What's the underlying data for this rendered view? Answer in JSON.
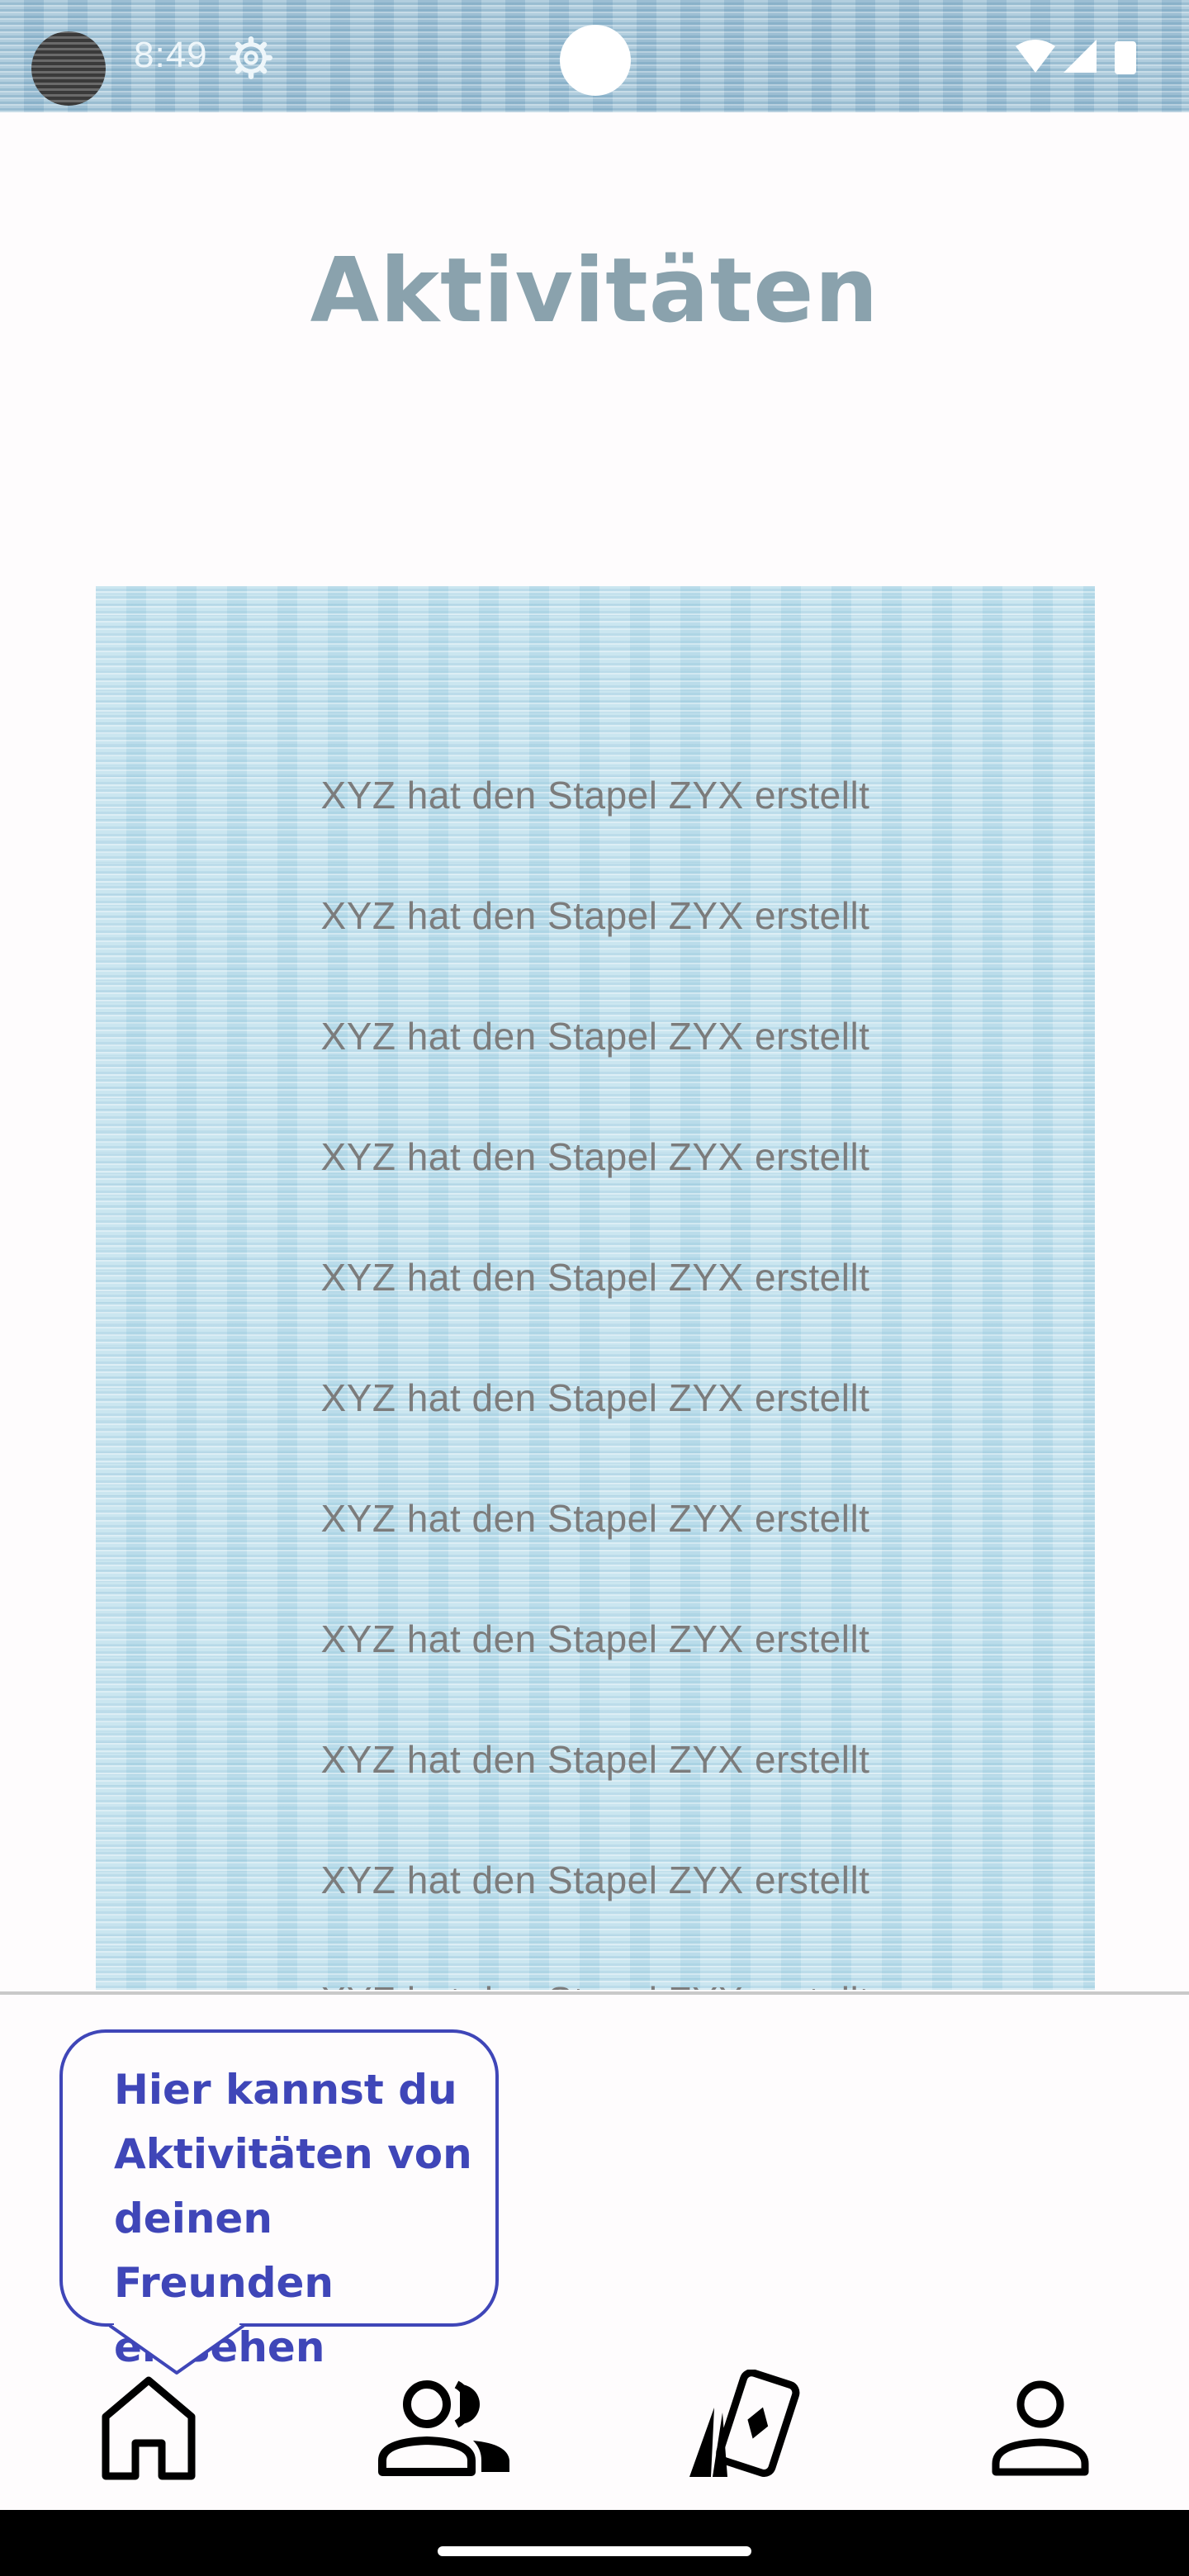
{
  "status_bar": {
    "time": "8:49",
    "icons": [
      "settings-gear-icon",
      "wifi-icon",
      "cellular-signal-icon",
      "battery-icon"
    ]
  },
  "page": {
    "title": "Aktivitäten"
  },
  "activities": [
    "XYZ hat den Stapel ZYX erstellt",
    "XYZ hat den Stapel ZYX erstellt",
    "XYZ hat den Stapel ZYX erstellt",
    "XYZ hat den Stapel ZYX erstellt",
    "XYZ hat den Stapel ZYX erstellt",
    "XYZ hat den Stapel ZYX erstellt",
    "XYZ hat den Stapel ZYX erstellt",
    "XYZ hat den Stapel ZYX erstellt",
    "XYZ hat den Stapel ZYX erstellt",
    "XYZ hat den Stapel ZYX erstellt",
    "XYZ hat den Stapel ZYX erstellt"
  ],
  "tooltip": {
    "text": "Hier kannst du Aktivitäten von deinen Freunden einsehen",
    "color": "#3f46b8"
  },
  "bottom_nav": {
    "items": [
      {
        "icon": "home-icon",
        "active": true
      },
      {
        "icon": "friends-icon",
        "active": false
      },
      {
        "icon": "card-deck-icon",
        "active": false
      },
      {
        "icon": "profile-icon",
        "active": false
      }
    ]
  },
  "colors": {
    "background": "#fefcfd",
    "card_texture": "#c4e2ee",
    "activity_text": "#7c7c7c",
    "title_text": "#8aa2ad",
    "nav_icon": "#000000"
  }
}
